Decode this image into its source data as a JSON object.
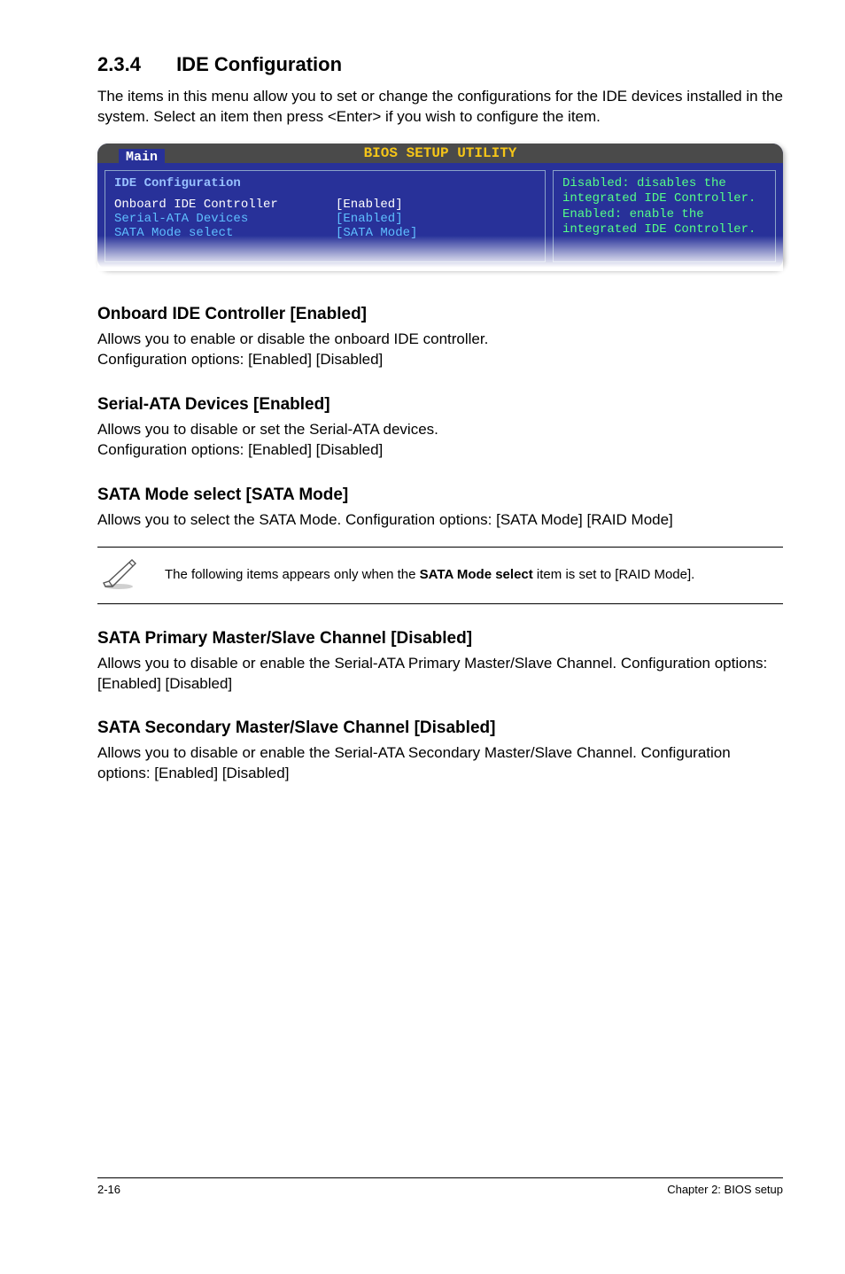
{
  "section": {
    "number": "2.3.4",
    "title": "IDE Configuration",
    "intro": "The items in this menu allow you to set or change the configurations for the IDE devices installed in the system. Select an item then press <Enter> if you wish to configure the item."
  },
  "bios": {
    "titlebar": "BIOS SETUP UTILITY",
    "tab": "Main",
    "panel_heading": "IDE Configuration",
    "rows": [
      {
        "label": "Onboard IDE Controller",
        "value": "[Enabled]",
        "selected": true
      },
      {
        "label": "Serial-ATA Devices",
        "value": "[Enabled]",
        "selected": false
      },
      {
        "label": "SATA Mode select",
        "value": "[SATA Mode]",
        "selected": false
      }
    ],
    "help": "Disabled: disables the integrated IDE Controller.\nEnabled: enable the integrated IDE Controller."
  },
  "options": [
    {
      "title": "Onboard IDE Controller [Enabled]",
      "desc": "Allows you to enable or disable the onboard IDE controller.\nConfiguration options: [Enabled] [Disabled]"
    },
    {
      "title": "Serial-ATA Devices [Enabled]",
      "desc": "Allows you to disable or set the Serial-ATA devices.\nConfiguration options: [Enabled] [Disabled]"
    },
    {
      "title": "SATA Mode select [SATA Mode]",
      "desc": "Allows you to select the SATA Mode. Configuration options: [SATA Mode] [RAID Mode]"
    },
    {
      "title": "SATA Primary Master/Slave Channel [Disabled]",
      "desc": "Allows you to disable or enable the Serial-ATA Primary Master/Slave Channel. Configuration options: [Enabled] [Disabled]"
    },
    {
      "title": "SATA Secondary Master/Slave Channel [Disabled]",
      "desc": "Allows you to disable or enable the Serial-ATA Secondary Master/Slave Channel. Configuration options: [Enabled] [Disabled]"
    }
  ],
  "note": {
    "text_pre": "The following items appears only when the ",
    "text_bold": "SATA Mode select",
    "text_post": " item is set to [RAID Mode]."
  },
  "footer": {
    "left": "2-16",
    "right": "Chapter 2: BIOS setup"
  }
}
